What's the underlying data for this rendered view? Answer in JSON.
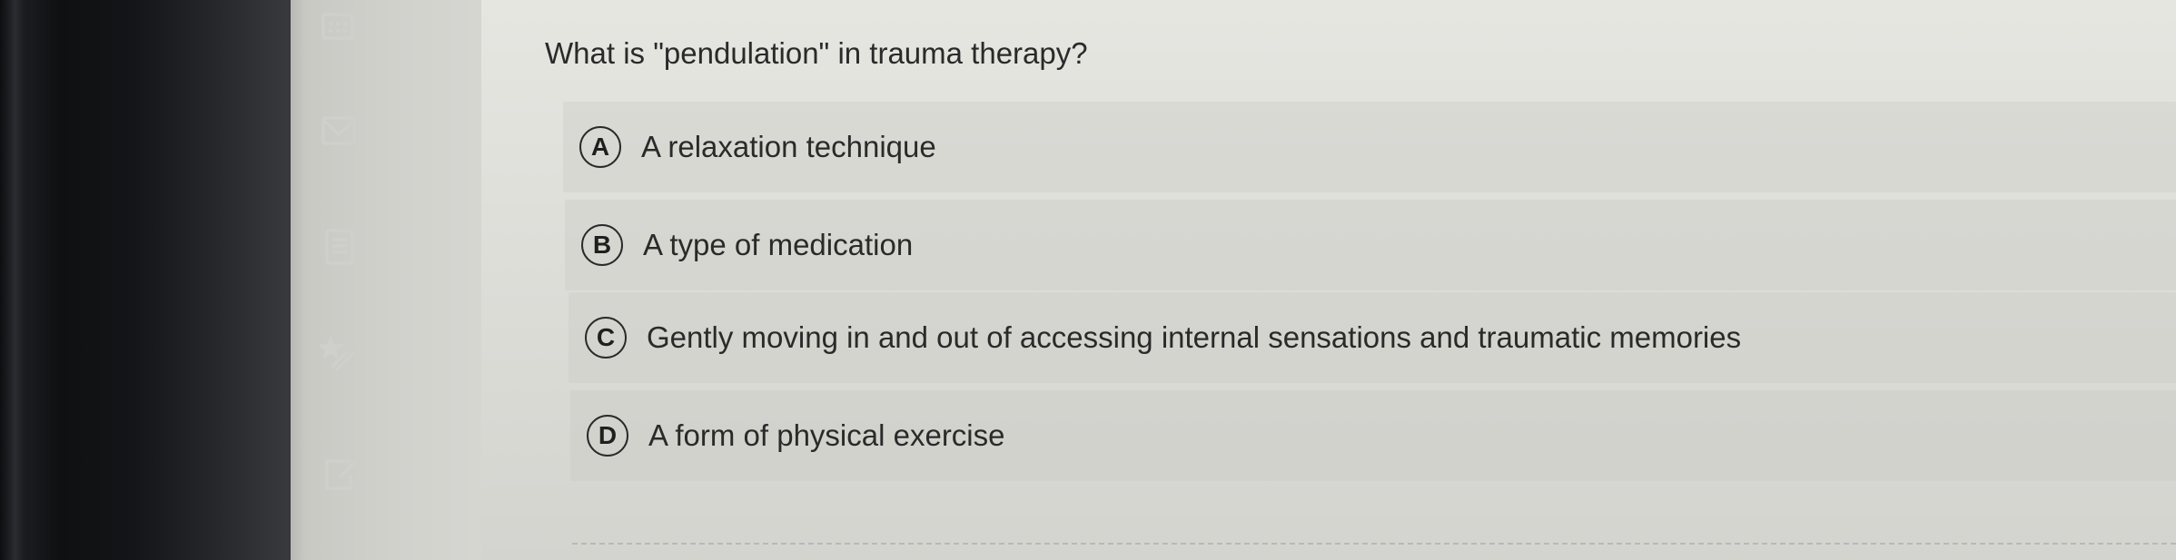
{
  "sidebar": {
    "icons": [
      {
        "name": "grid-icon"
      },
      {
        "name": "mail-icon"
      },
      {
        "name": "document-icon"
      },
      {
        "name": "star-edit-icon"
      },
      {
        "name": "edit-box-icon"
      }
    ]
  },
  "quiz": {
    "question": "What is \"pendulation\" in trauma therapy?",
    "options": [
      {
        "letter": "A",
        "text": "A relaxation technique"
      },
      {
        "letter": "B",
        "text": "A type of medication"
      },
      {
        "letter": "C",
        "text": "Gently moving in and out of accessing internal sensations and traumatic memories"
      },
      {
        "letter": "D",
        "text": "A form of physical exercise"
      }
    ]
  }
}
